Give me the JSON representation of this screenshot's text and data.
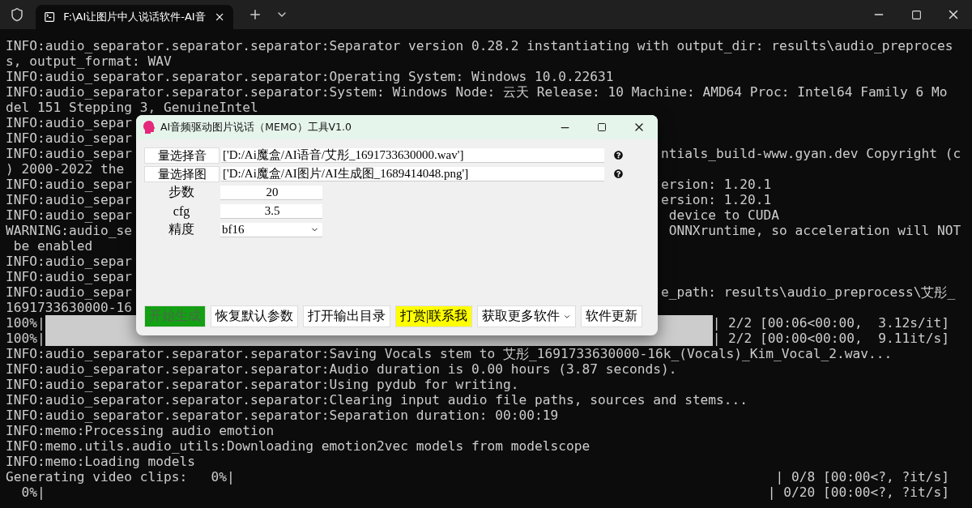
{
  "tab_bar": {
    "tabs": [
      {
        "title": "F:\\AI让图片中人说话软件-AI音",
        "selected": true
      }
    ]
  },
  "terminal": {
    "lines": [
      {
        "kind": "text",
        "left": "INFO:audio_separator.separator.separator:Separator version 0.28.2 instantiating with output_dir: results\\audio_preproces"
      },
      {
        "kind": "text",
        "left": "s, output_format: WAV"
      },
      {
        "kind": "text",
        "left": "INFO:audio_separator.separator.separator:Operating System: Windows 10.0.22631"
      },
      {
        "kind": "text",
        "left": "INFO:audio_separator.separator.separator:System: Windows Node: 云天 Release: 10 Machine: AMD64 Proc: Intel64 Family 6 Mo"
      },
      {
        "kind": "text",
        "left": "del 151 Stepping 3, GenuineIntel"
      },
      {
        "kind": "split",
        "left": "INFO:audio_separ"
      },
      {
        "kind": "split",
        "left": "INFO:audio_separ"
      },
      {
        "kind": "split",
        "left": "INFO:audio_separ",
        "right": "ntials_build-www.gyan.dev Copyright (c"
      },
      {
        "kind": "split",
        "left": ") 2000-2022 the"
      },
      {
        "kind": "split",
        "left": "INFO:audio_separ",
        "right": "ersion: 1.20.1"
      },
      {
        "kind": "split",
        "left": "INFO:audio_separ",
        "right": "ersion: 1.20.1"
      },
      {
        "kind": "split",
        "left": "INFO:audio_separ",
        "right": " device to CUDA"
      },
      {
        "kind": "split",
        "left": "WARNING:audio_se",
        "right": " ONNXruntime, so acceleration will NOT"
      },
      {
        "kind": "split",
        "left": " be enabled"
      },
      {
        "kind": "split",
        "left": "INFO:audio_separ"
      },
      {
        "kind": "split",
        "left": "INFO:audio_separ"
      },
      {
        "kind": "split",
        "left": "INFO:audio_separ",
        "right": "e_path: results\\audio_preprocess\\艾彤_"
      },
      {
        "kind": "split",
        "left": "1691733630000-16"
      },
      {
        "kind": "bar_full",
        "left": "100%|",
        "right": "| 2/2 [00:06<00:00,  3.12s/it]"
      },
      {
        "kind": "bar_full",
        "left": "100%|",
        "right": "| 2/2 [00:00<00:00,  9.11it/s]"
      },
      {
        "kind": "text",
        "left": "INFO:audio_separator.separator.separator:Saving Vocals stem to 艾彤_1691733630000-16k_(Vocals)_Kim_Vocal_2.wav..."
      },
      {
        "kind": "text",
        "left": "INFO:audio_separator.separator.separator:Audio duration is 0.00 hours (3.87 seconds)."
      },
      {
        "kind": "text",
        "left": "INFO:audio_separator.separator.separator:Using pydub for writing."
      },
      {
        "kind": "text",
        "left": "INFO:audio_separator.separator.separator:Clearing input audio file paths, sources and stems..."
      },
      {
        "kind": "text",
        "left": "INFO:audio_separator.separator.separator:Separation duration: 00:00:19"
      },
      {
        "kind": "text",
        "left": "INFO:memo:Processing audio emotion"
      },
      {
        "kind": "text",
        "left": "INFO:memo.utils.audio_utils:Downloading emotion2vec models from modelscope"
      },
      {
        "kind": "text",
        "left": "INFO:memo:Loading models"
      },
      {
        "kind": "bar_empty",
        "left": "Generating video clips:   0%|",
        "right": "| 0/8 [00:00<?, ?it/s]"
      },
      {
        "kind": "bar_empty",
        "left": "  0%|",
        "right": "| 0/20 [00:00<?, ?it/s]"
      }
    ]
  },
  "dialog": {
    "title": "AI音频驱动图片说话（MEMO）工具V1.0",
    "file_rows": [
      {
        "label": "量选择音",
        "value": "['D:/Ai魔盒/AI语音/艾彤_1691733630000.wav']"
      },
      {
        "label": "量选择图",
        "value": "['D:/Ai魔盒/AI图片/AI生成图_1689414048.png']"
      }
    ],
    "params": [
      {
        "kind": "entry",
        "label": "步数",
        "value": "20"
      },
      {
        "kind": "entry",
        "label": "cfg",
        "value": "3.5"
      },
      {
        "kind": "select",
        "label": "精度",
        "value": "bf16"
      }
    ],
    "buttons": [
      {
        "label": "开始生成",
        "color": "#14a014",
        "disabled": true,
        "menu": false
      },
      {
        "label": "恢复默认参数",
        "color": "#ffffff",
        "disabled": false,
        "menu": false
      },
      {
        "label": "打开输出目录",
        "color": "#ffffff",
        "disabled": false,
        "menu": false
      },
      {
        "label": "打赏|联系我",
        "color": "#ffff00",
        "disabled": false,
        "menu": false
      },
      {
        "label": "获取更多软件",
        "color": "#ffffff",
        "disabled": false,
        "menu": true
      },
      {
        "label": "软件更新",
        "color": "#ffffff",
        "disabled": false,
        "menu": false
      }
    ]
  }
}
